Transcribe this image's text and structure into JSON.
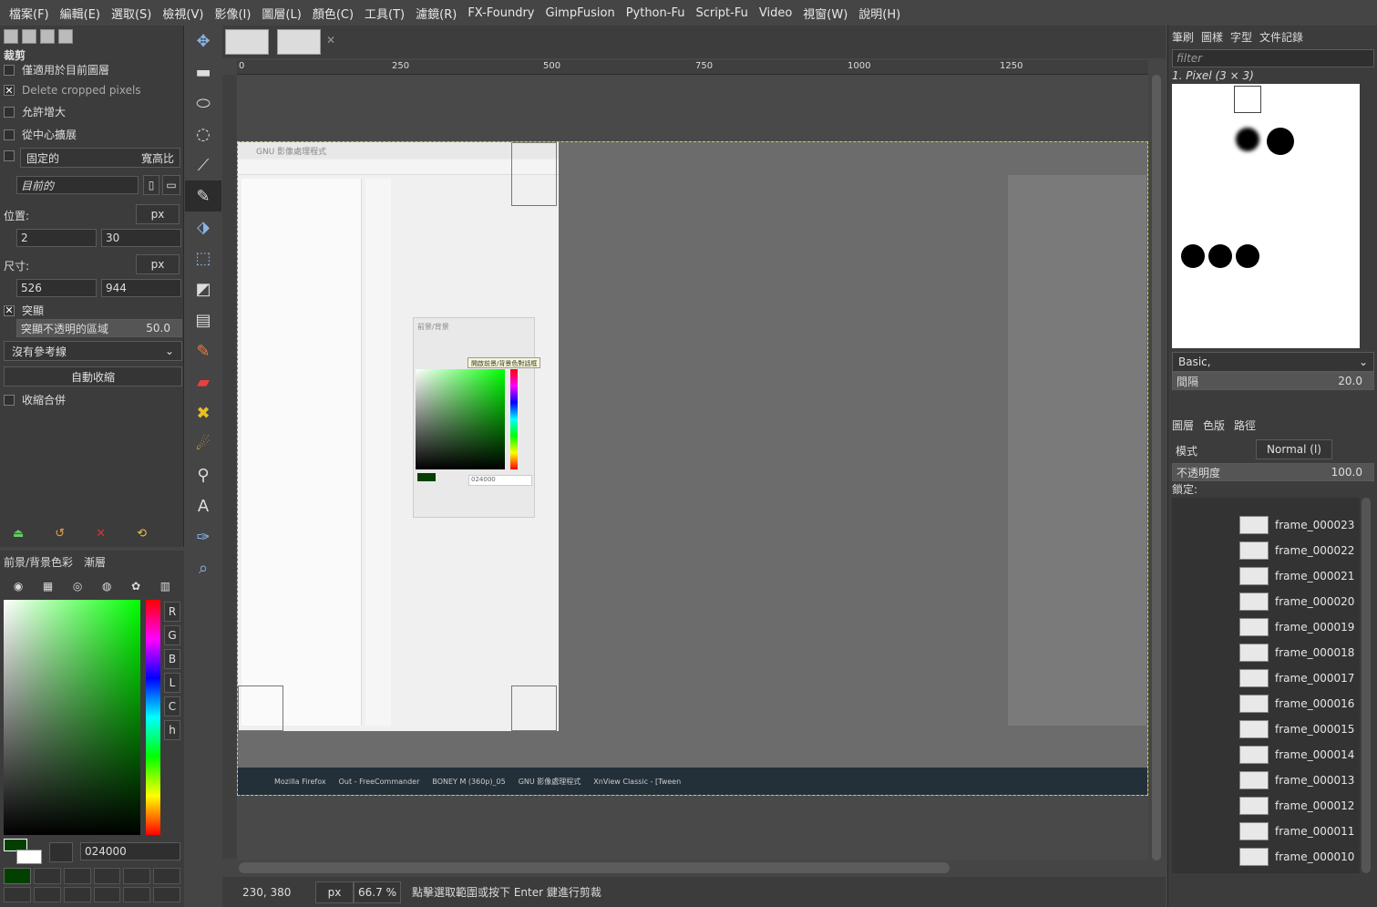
{
  "menubar": [
    "檔案(F)",
    "編輯(E)",
    "選取(S)",
    "檢視(V)",
    "影像(I)",
    "圖層(L)",
    "顏色(C)",
    "工具(T)",
    "濾鏡(R)",
    "FX-Foundry",
    "GimpFusion",
    "Python-Fu",
    "Script-Fu",
    "Video",
    "視窗(W)",
    "說明(H)"
  ],
  "tool_options": {
    "title": "裁剪",
    "only_current_layer": "僅適用於目前圖層",
    "delete_cropped": "Delete cropped pixels",
    "allow_growing": "允許增大",
    "expand_center": "從中心擴展",
    "fixed_label": "固定的",
    "fixed_mode": "寬高比",
    "current_value": "目前的",
    "position_label": "位置:",
    "position_unit": "px",
    "pos_x": "2",
    "pos_y": "30",
    "size_label": "尺寸:",
    "size_unit": "px",
    "size_w": "526",
    "size_h": "944",
    "highlight": "突顯",
    "highlight_opacity_label": "突顯不透明的區域",
    "highlight_opacity_value": "50.0",
    "guides": "沒有參考線",
    "autoshrink": "自動收縮",
    "shrink_merged": "收縮合併"
  },
  "fgbg_panel": {
    "tab1": "前景/背景色彩",
    "tab2": "漸層",
    "channels": [
      "R",
      "G",
      "B",
      "L",
      "C",
      "h"
    ],
    "hex": "024000",
    "fg_color": "#024000"
  },
  "ruler": {
    "top": [
      "0",
      "250",
      "500",
      "750",
      "1000",
      "1250"
    ]
  },
  "status": {
    "coords": "230, 380",
    "unit": "px",
    "zoom": "66.7 %",
    "message": "點擊選取範圍或按下 Enter 鍵進行剪裁"
  },
  "right_dock": {
    "tabs": [
      "筆刷",
      "圖樣",
      "字型",
      "文件記錄"
    ],
    "filter_placeholder": "filter",
    "brush_name": "1. Pixel (3 × 3)",
    "preset": "Basic,",
    "spacing_label": "間隔",
    "spacing_value": "20.0",
    "layer_tabs": [
      "圖層",
      "色版",
      "路徑"
    ],
    "mode_label": "模式",
    "mode_value": "Normal (l)",
    "opacity_label": "不透明度",
    "opacity_value": "100.0",
    "lock_label": "鎖定:",
    "layers": [
      "frame_000023",
      "frame_000022",
      "frame_000021",
      "frame_000020",
      "frame_000019",
      "frame_000018",
      "frame_000017",
      "frame_000016",
      "frame_000015",
      "frame_000014",
      "frame_000013",
      "frame_000012",
      "frame_000011",
      "frame_000010"
    ]
  },
  "screenshot_content": {
    "taskbar": [
      "Mozilla Firefox",
      "Out - FreeCommander",
      "BONEY M (360p)_05",
      "GNU 影像處理程式",
      "XnView Classic - [Tween"
    ],
    "inner_title": "GNU 影像處理程式",
    "inner_tooltip": "開啟前景/背景色對話框",
    "inner_hex": "024000",
    "inner_dialog_title": "前景/背景"
  }
}
